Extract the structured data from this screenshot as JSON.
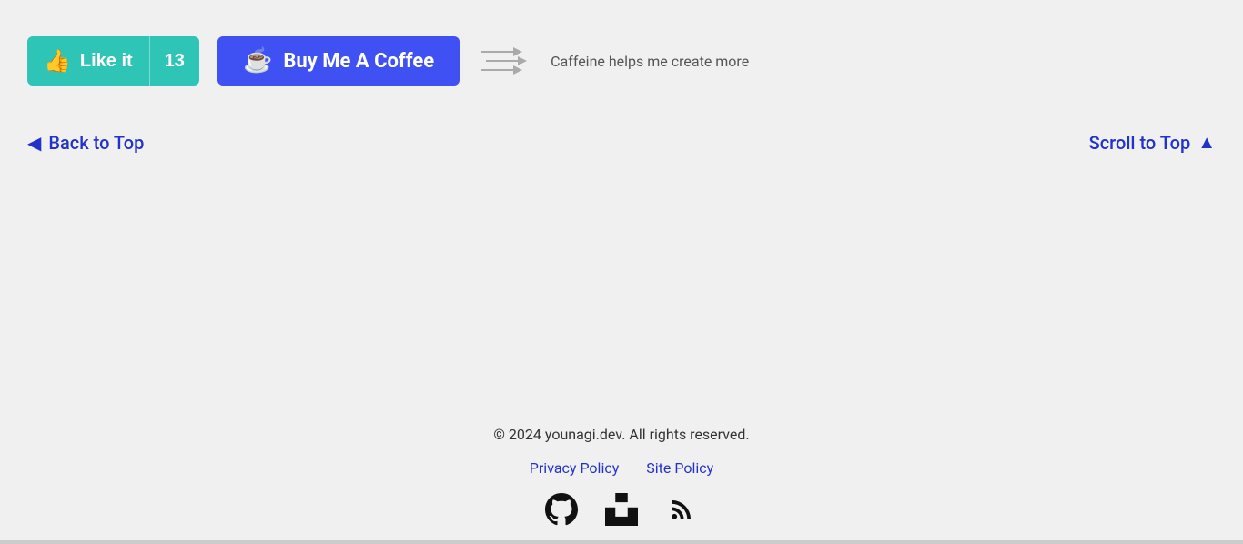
{
  "actions": {
    "like_label": "Like it",
    "like_count": "13",
    "buy_coffee_label": "Buy Me A Coffee",
    "caffeine_text": "Caffeine helps me create more"
  },
  "navigation": {
    "back_to_top": "Back to Top",
    "scroll_to_top": "Scroll to Top"
  },
  "footer": {
    "copyright": "© 2024 younagi.dev. All rights reserved.",
    "links": [
      {
        "label": "Privacy Policy"
      },
      {
        "label": "Site Policy"
      }
    ]
  },
  "icons": {
    "github": "github-icon",
    "unsplash": "unsplash-icon",
    "rss": "rss-icon"
  }
}
